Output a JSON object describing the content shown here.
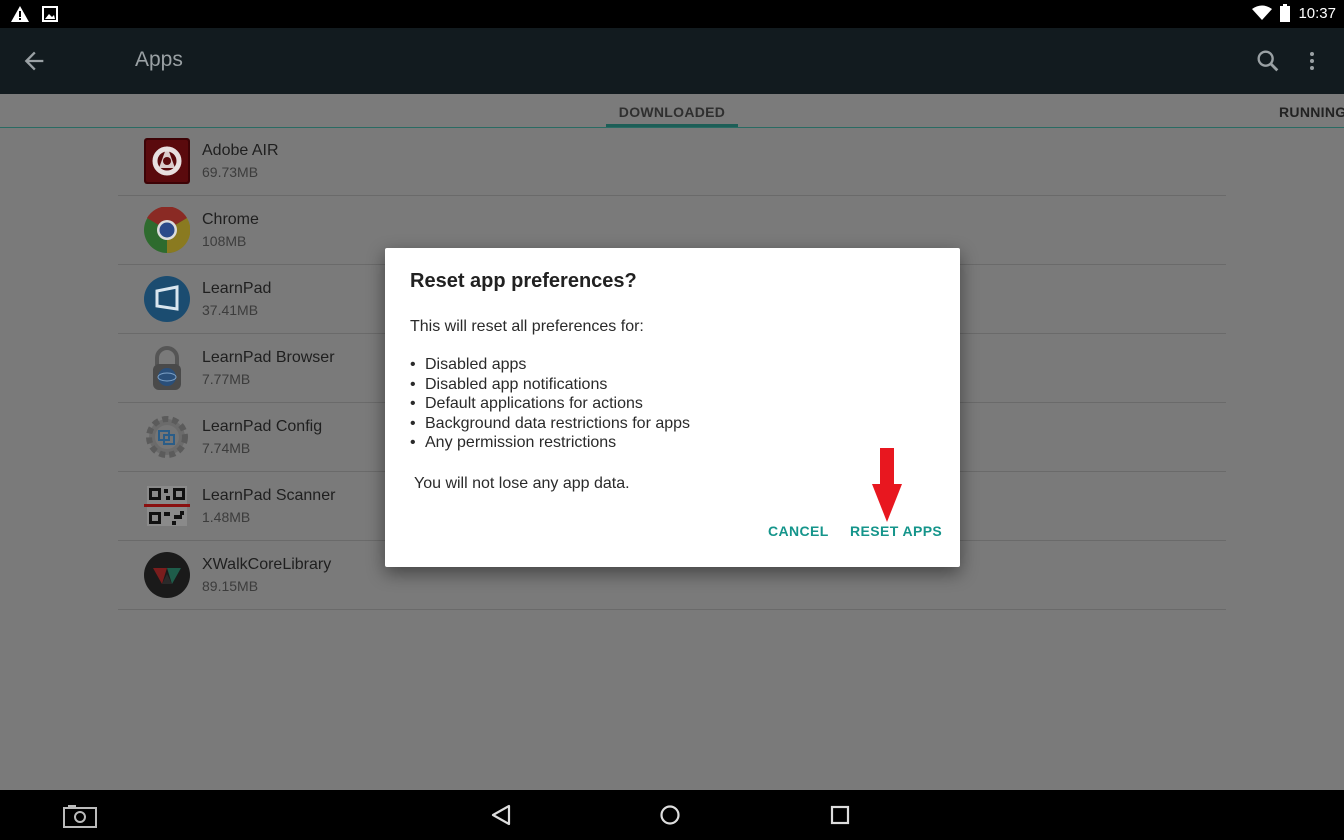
{
  "status_bar": {
    "time": "10:37",
    "icons": [
      "warning-icon",
      "image-icon",
      "wifi-icon",
      "battery-icon"
    ]
  },
  "app_bar": {
    "title": "Apps",
    "icons": [
      "back-arrow-icon",
      "search-icon",
      "more-vert-icon"
    ]
  },
  "tabs": [
    {
      "label": "DOWNLOADED",
      "selected": true
    },
    {
      "label": "RUNNING",
      "selected": false
    }
  ],
  "apps": [
    {
      "name": "Adobe AIR",
      "size": "69.73MB",
      "icon": "adobe-air-icon"
    },
    {
      "name": "Chrome",
      "size": "108MB",
      "icon": "chrome-icon"
    },
    {
      "name": "LearnPad",
      "size": "37.41MB",
      "icon": "learnpad-icon"
    },
    {
      "name": "LearnPad Browser",
      "size": "7.77MB",
      "icon": "learnpad-browser-icon"
    },
    {
      "name": "LearnPad Config",
      "size": "7.74MB",
      "icon": "learnpad-config-icon"
    },
    {
      "name": "LearnPad Scanner",
      "size": "1.48MB",
      "icon": "learnpad-scanner-icon"
    },
    {
      "name": "XWalkCoreLibrary",
      "size": "89.15MB",
      "icon": "xwalk-icon"
    }
  ],
  "dialog": {
    "title": "Reset app preferences?",
    "intro": "This will reset all preferences for:",
    "items": [
      "Disabled apps",
      "Disabled app notifications",
      "Default applications for actions",
      "Background data restrictions for apps",
      "Any permission restrictions"
    ],
    "note": "You will not lose any app data.",
    "cancel_label": "CANCEL",
    "confirm_label": "RESET APPS"
  },
  "colors": {
    "accent": "#15958b",
    "annotation_arrow": "#e8171f"
  },
  "nav_bar": {
    "icons": [
      "screenshot-camera-icon",
      "back-icon",
      "home-icon",
      "recents-icon"
    ]
  }
}
